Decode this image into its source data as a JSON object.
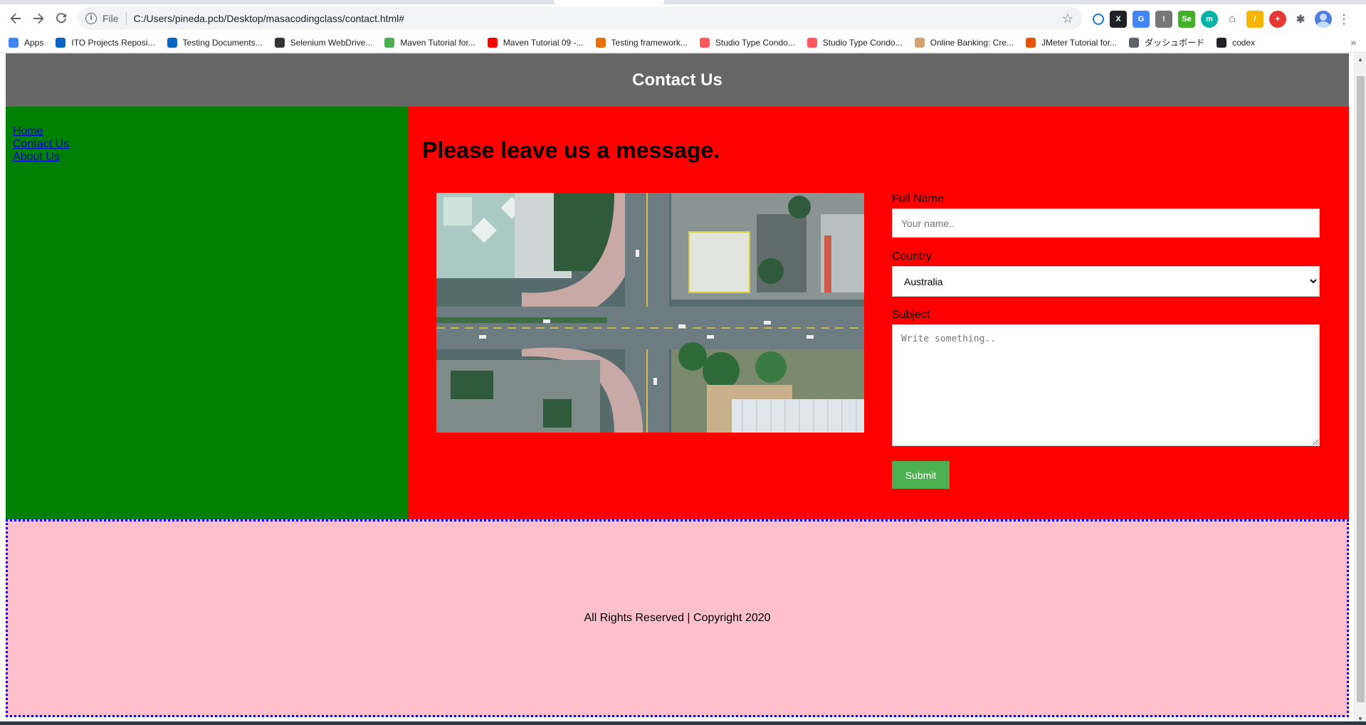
{
  "browser": {
    "nav": {
      "back_icon": "back-arrow-icon",
      "forward_icon": "forward-arrow-icon",
      "reload_icon": "reload-icon"
    },
    "omnibox": {
      "scheme_label": "File",
      "url": "C:/Users/pineda.pcb/Desktop/masacodingclass/contact.html#"
    },
    "bookmarks": [
      {
        "label": "Apps",
        "color": "#4285f4"
      },
      {
        "label": "ITO Projects Reposi...",
        "color": "#0a66c2"
      },
      {
        "label": "Testing Documents...",
        "color": "#0a66c2"
      },
      {
        "label": "Selenium WebDrive...",
        "color": "#333333"
      },
      {
        "label": "Maven Tutorial for...",
        "color": "#4caf50"
      },
      {
        "label": "Maven Tutorial 09 -...",
        "color": "#ff0000"
      },
      {
        "label": "Testing framework...",
        "color": "#e8710a"
      },
      {
        "label": "Studio Type Condo...",
        "color": "#ff5a5f"
      },
      {
        "label": "Studio Type Condo...",
        "color": "#ff5a5f"
      },
      {
        "label": "Online Banking: Cre...",
        "color": "#d4a373"
      },
      {
        "label": "JMeter Tutorial for...",
        "color": "#e8550a"
      },
      {
        "label": "ダッシュボード",
        "color": "#5f6368"
      },
      {
        "label": "codex",
        "color": "#202124"
      }
    ]
  },
  "page": {
    "header_title": "Contact Us",
    "sidenav": [
      "Home",
      "Contact Us",
      "About Us"
    ],
    "main_heading": "Please leave us a message.",
    "form": {
      "fullname_label": "Full Name",
      "fullname_placeholder": "Your name..",
      "country_label": "Country",
      "country_selected": "Australia",
      "subject_label": "Subject",
      "subject_placeholder": "Write something..",
      "submit_label": "Submit"
    },
    "footer_text": "All Rights Reserved | Copyright 2020"
  },
  "colors": {
    "header_bg": "#666666",
    "sidenav_bg": "#008000",
    "main_bg": "#ff0000",
    "footer_bg": "#ffc0cb",
    "footer_border": "#0000ff",
    "submit_bg": "#4caf50"
  }
}
